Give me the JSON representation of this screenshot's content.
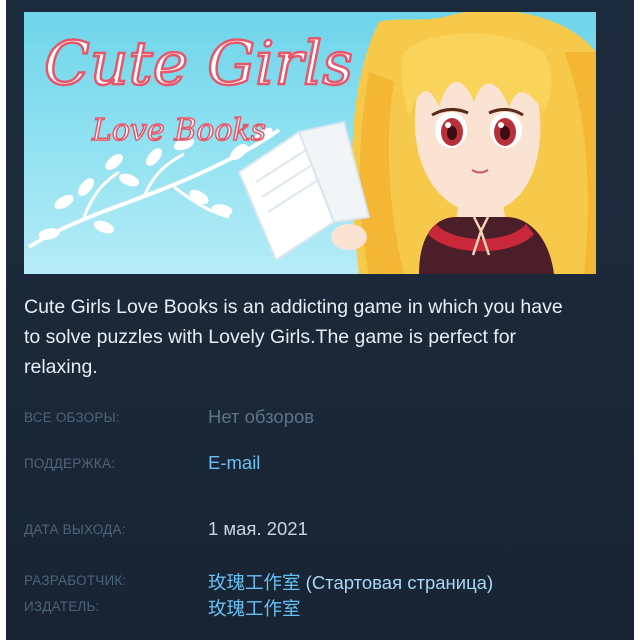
{
  "banner": {
    "title_line1": "Cute Girls",
    "title_line2": "Love Books"
  },
  "description": "Cute Girls Love Books is an addicting game in which you have to solve puzzles with Lovely Girls.The game is perfect for relaxing.",
  "details": {
    "reviews": {
      "label": "ВСЕ ОБЗОРЫ:",
      "value": "Нет обзоров"
    },
    "support": {
      "label": "ПОДДЕРЖКА:",
      "value": "E-mail"
    },
    "release": {
      "label": "ДАТА ВЫХОДА:",
      "value": "1 мая. 2021"
    },
    "developer": {
      "label": "РАЗРАБОТЧИК:",
      "name": "玫瑰工作室",
      "homepage": "(Стартовая страница)"
    },
    "publisher": {
      "label": "ИЗДАТЕЛЬ:",
      "name": "玫瑰工作室"
    }
  },
  "colors": {
    "panel_bg": "#1b2838",
    "link": "#66c0f4",
    "label": "#4d6578",
    "text": "#e6eef4"
  }
}
